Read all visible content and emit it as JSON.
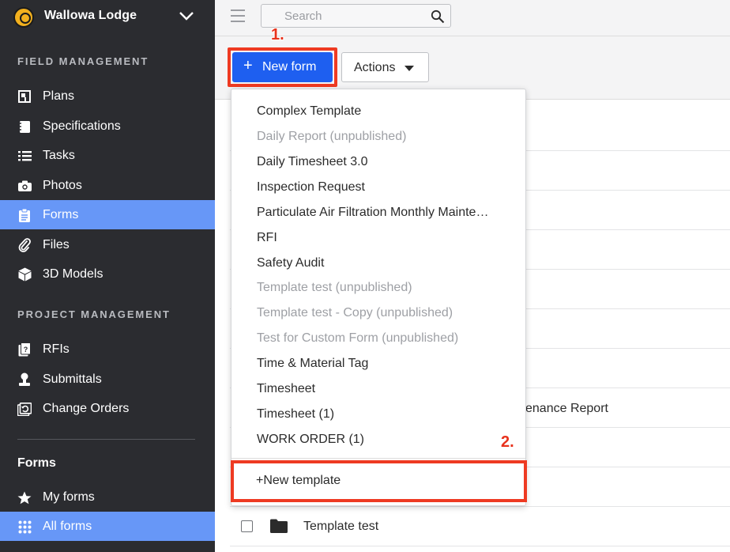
{
  "project": {
    "name": "Wallowa Lodge",
    "logo_icon": "hardhat-icon",
    "chevron_icon": "chevron-down-icon"
  },
  "sidebar": {
    "field_heading": "FIELD MANAGEMENT",
    "field_items": [
      {
        "label": "Plans",
        "icon": "plans-icon"
      },
      {
        "label": "Specifications",
        "icon": "specifications-icon"
      },
      {
        "label": "Tasks",
        "icon": "tasks-list-icon"
      },
      {
        "label": "Photos",
        "icon": "camera-icon"
      },
      {
        "label": "Forms",
        "icon": "clipboard-icon",
        "active": true
      },
      {
        "label": "Files",
        "icon": "paperclip-icon"
      },
      {
        "label": "3D Models",
        "icon": "cube-icon"
      }
    ],
    "project_heading": "PROJECT MANAGEMENT",
    "project_items": [
      {
        "label": "RFIs",
        "icon": "rfi-icon"
      },
      {
        "label": "Submittals",
        "icon": "submittal-icon"
      },
      {
        "label": "Change Orders",
        "icon": "change-orders-icon"
      }
    ],
    "forms_heading": "Forms",
    "forms_items": [
      {
        "label": "My forms",
        "icon": "star-icon"
      },
      {
        "label": "All forms",
        "icon": "grid-icon",
        "active": true
      }
    ]
  },
  "topbar": {
    "search_placeholder": "Search"
  },
  "toolbar": {
    "new_form_label": "New form",
    "new_form_plus": "+",
    "actions_label": "Actions"
  },
  "annotations": {
    "step1": "1.",
    "step2": "2."
  },
  "table": {
    "partial_row_text": "enance Report",
    "last_row_text": "Template test"
  },
  "dropdown": {
    "items": [
      {
        "label": "Complex Template",
        "published": true
      },
      {
        "label": "Daily Report (unpublished)",
        "published": false
      },
      {
        "label": "Daily Timesheet 3.0",
        "published": true
      },
      {
        "label": "Inspection Request",
        "published": true
      },
      {
        "label": "Particulate Air Filtration Monthly Mainte…",
        "published": true
      },
      {
        "label": "RFI",
        "published": true
      },
      {
        "label": "Safety Audit",
        "published": true
      },
      {
        "label": "Template test (unpublished)",
        "published": false
      },
      {
        "label": "Template test - Copy (unpublished)",
        "published": false
      },
      {
        "label": "Test for Custom Form (unpublished)",
        "published": false
      },
      {
        "label": "Time & Material Tag",
        "published": true
      },
      {
        "label": "Timesheet",
        "published": true
      },
      {
        "label": "Timesheet (1)",
        "published": true
      },
      {
        "label": "WORK ORDER (1)",
        "published": true
      }
    ],
    "new_template_label": "+New template"
  },
  "colors": {
    "sidebar_bg": "#2b2c30",
    "active_nav": "#6797f7",
    "primary_button": "#1e5ff0",
    "highlight": "#ee3a22",
    "unpublished_text": "#9ea0a5"
  }
}
